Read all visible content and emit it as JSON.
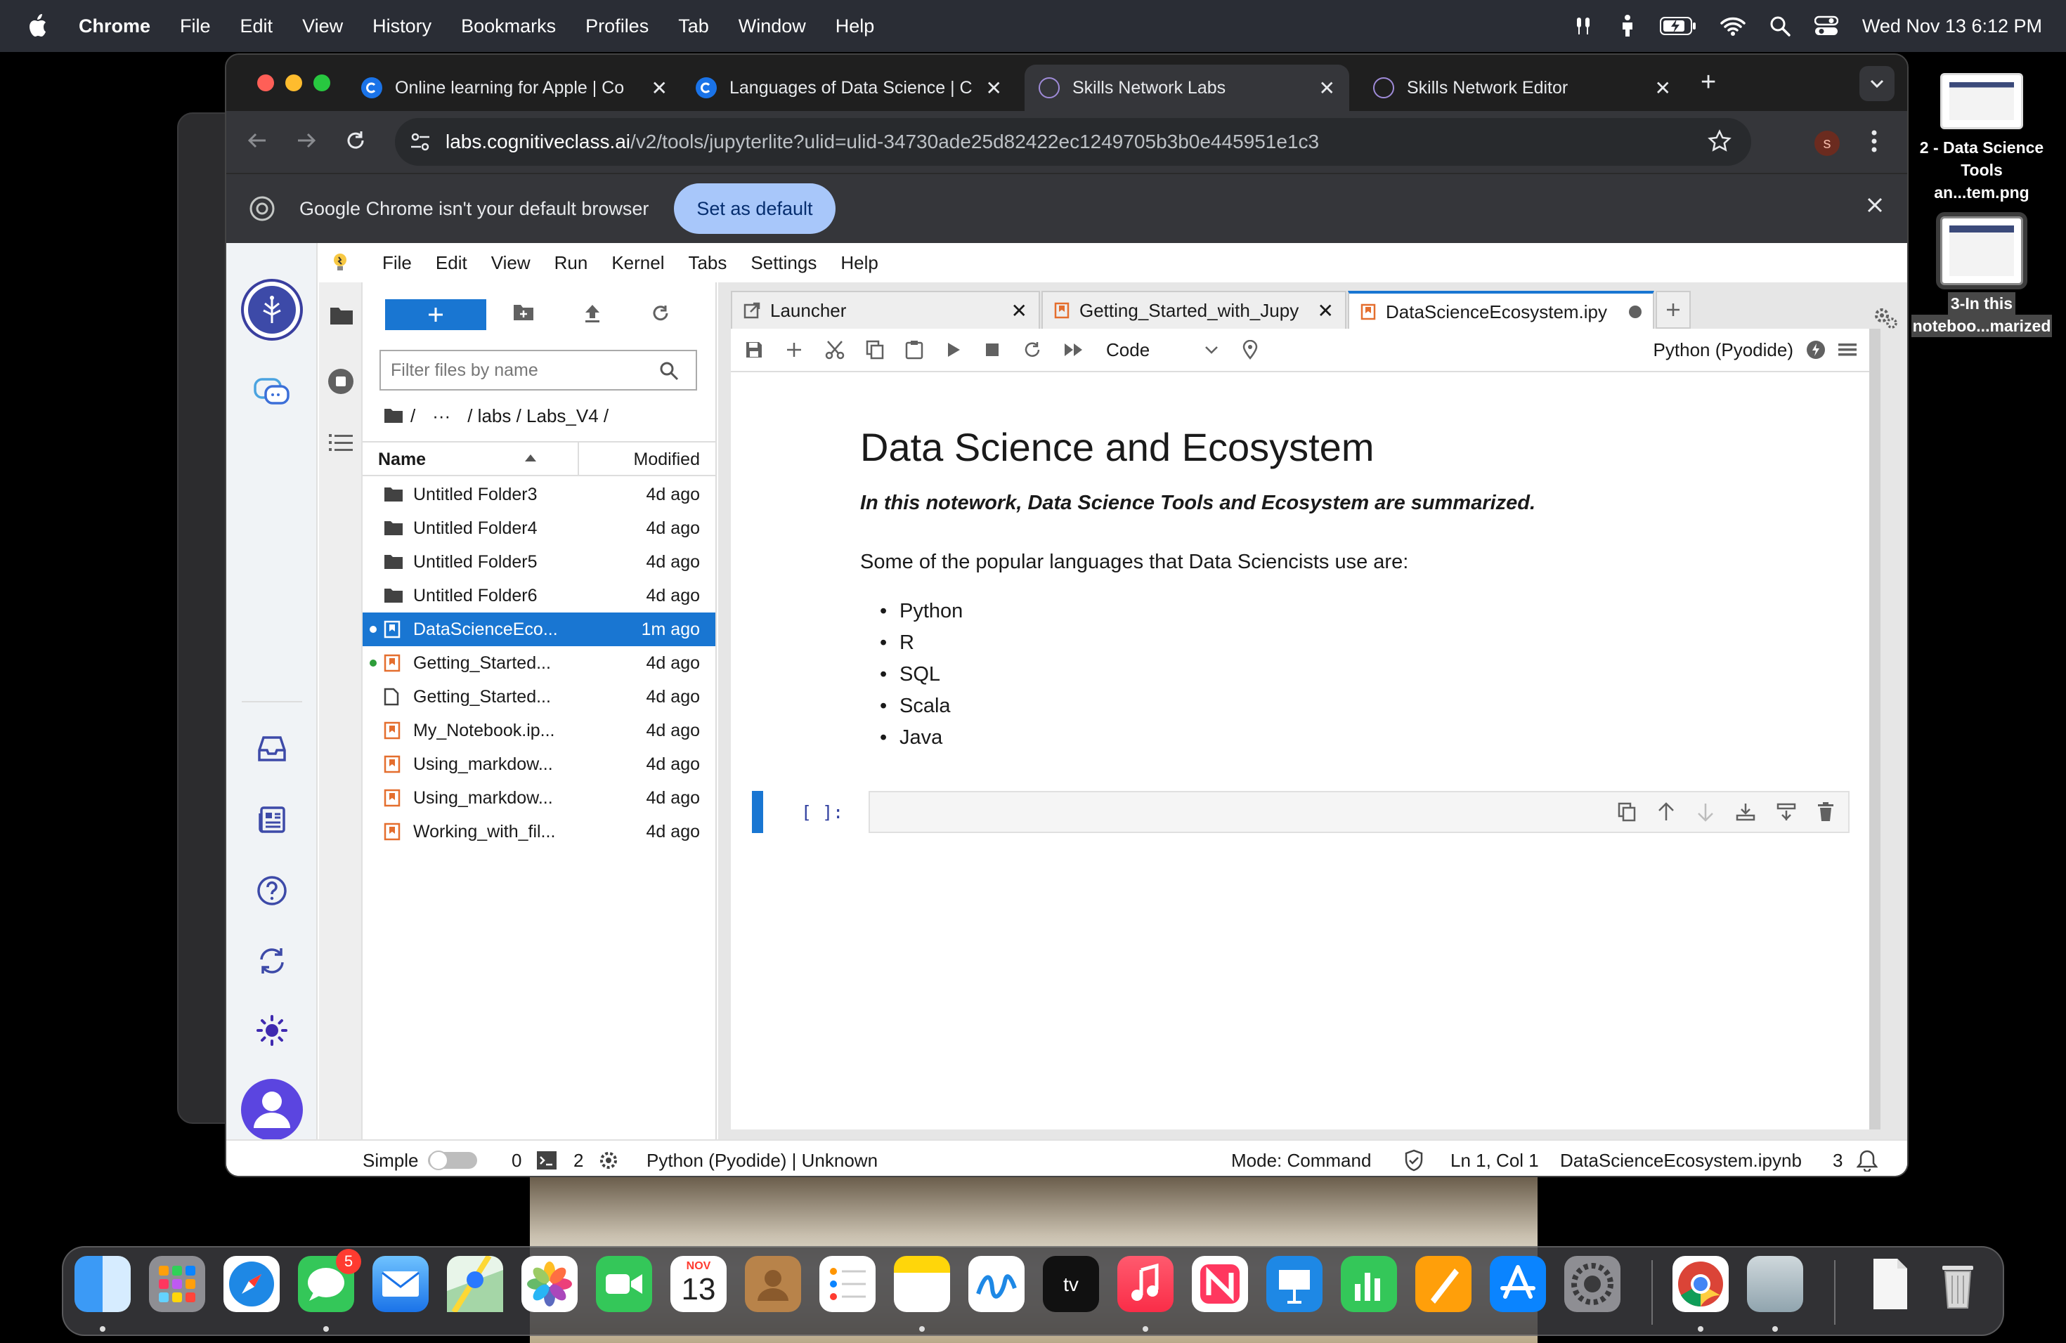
{
  "menubar": {
    "app_name": "Chrome",
    "items": [
      "File",
      "Edit",
      "View",
      "History",
      "Bookmarks",
      "Profiles",
      "Tab",
      "Window",
      "Help"
    ],
    "clock": "Wed Nov 13  6:12 PM"
  },
  "desktop": {
    "file1_label_line1": "2 - Data Science",
    "file1_label_line2": "Tools an...tem.png",
    "file2_label_line1": "3-In this",
    "file2_label_line2": "noteboo...marized"
  },
  "browser": {
    "tabs": [
      {
        "title": "Online learning for Apple | Co",
        "favicon": "C"
      },
      {
        "title": "Languages of Data Science | C",
        "favicon": "C"
      },
      {
        "title": "Skills Network Labs",
        "favicon": "skills-network"
      },
      {
        "title": "Skills Network Editor",
        "favicon": "skills-network"
      }
    ],
    "url_host": "labs.cognitiveclass.ai",
    "url_path": "/v2/tools/jupyterlite?ulid=ulid-34730ade25d82422ec1249705b3b0e445951e1c3",
    "profile_initial": "s",
    "infobar_text": "Google Chrome isn't your default browser",
    "infobar_button": "Set as default"
  },
  "jupyter": {
    "menu": [
      "File",
      "Edit",
      "View",
      "Run",
      "Kernel",
      "Tabs",
      "Settings",
      "Help"
    ],
    "filter_placeholder": "Filter files by name",
    "breadcrumb": [
      "/",
      "···",
      "/ labs / Labs_V4 /"
    ],
    "columns": {
      "name": "Name",
      "modified": "Modified"
    },
    "files": [
      {
        "name": "Untitled Folder3",
        "modified": "4d ago",
        "type": "folder"
      },
      {
        "name": "Untitled Folder4",
        "modified": "4d ago",
        "type": "folder"
      },
      {
        "name": "Untitled Folder5",
        "modified": "4d ago",
        "type": "folder"
      },
      {
        "name": "Untitled Folder6",
        "modified": "4d ago",
        "type": "folder"
      },
      {
        "name": "DataScienceEco...",
        "modified": "1m ago",
        "type": "notebook"
      },
      {
        "name": "Getting_Started...",
        "modified": "4d ago",
        "type": "notebook"
      },
      {
        "name": "Getting_Started...",
        "modified": "4d ago",
        "type": "file"
      },
      {
        "name": "My_Notebook.ip...",
        "modified": "4d ago",
        "type": "notebook"
      },
      {
        "name": "Using_markdow...",
        "modified": "4d ago",
        "type": "notebook"
      },
      {
        "name": "Using_markdow...",
        "modified": "4d ago",
        "type": "notebook"
      },
      {
        "name": "Working_with_fil...",
        "modified": "4d ago",
        "type": "notebook"
      }
    ],
    "doc_tabs": [
      "Launcher",
      "Getting_Started_with_Jupy",
      "DataScienceEcosystem.ipy"
    ],
    "cell_type": "Code",
    "kernel_name": "Python (Pyodide)",
    "notebook": {
      "title": "Data Science and Ecosystem",
      "intro": "In this notework, Data Science Tools and Ecosystem are summarized.",
      "lead": "Some of the popular languages that Data Sciencists use are:",
      "languages": [
        "Python",
        "R",
        "SQL",
        "Scala",
        "Java"
      ],
      "prompt": "[ ]:"
    },
    "status": {
      "mode_label": "Simple",
      "terminals": "0",
      "kernels": "2",
      "kernel_status": "Python (Pyodide) | Unknown",
      "mode": "Mode: Command",
      "cursor": "Ln 1, Col 1",
      "filename": "DataScienceEcosystem.ipynb",
      "notifications": "3"
    }
  },
  "dock": {
    "messages_badge": "5",
    "calendar_month": "NOV",
    "calendar_day": "13"
  }
}
